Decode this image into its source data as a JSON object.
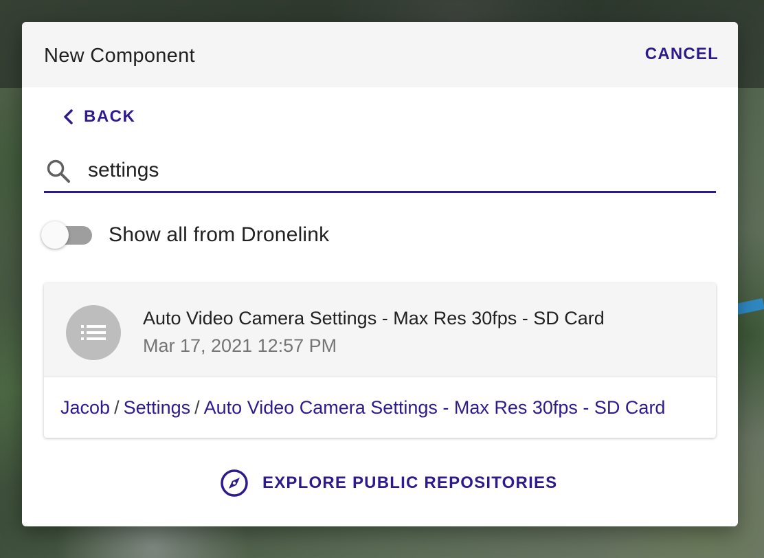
{
  "dialog": {
    "title": "New Component",
    "cancel_label": "CANCEL",
    "back_label": "BACK"
  },
  "search": {
    "value": "settings",
    "icon": "search-icon"
  },
  "toggle": {
    "label": "Show all from Dronelink",
    "checked": false
  },
  "results": [
    {
      "title": "Auto Video Camera Settings - Max Res 30fps - SD Card",
      "date": "Mar 17, 2021 12:57 PM",
      "icon": "list-icon",
      "path": [
        "Jacob",
        "Settings",
        "Auto Video Camera Settings - Max Res 30fps - SD Card"
      ],
      "path_separator": "/"
    }
  ],
  "explore": {
    "label": "EXPLORE PUBLIC REPOSITORIES",
    "icon": "compass-icon"
  },
  "colors": {
    "accent": "#2e1a8c",
    "header_bg": "#f5f5f5",
    "toggle_track": "#9e9e9e"
  }
}
